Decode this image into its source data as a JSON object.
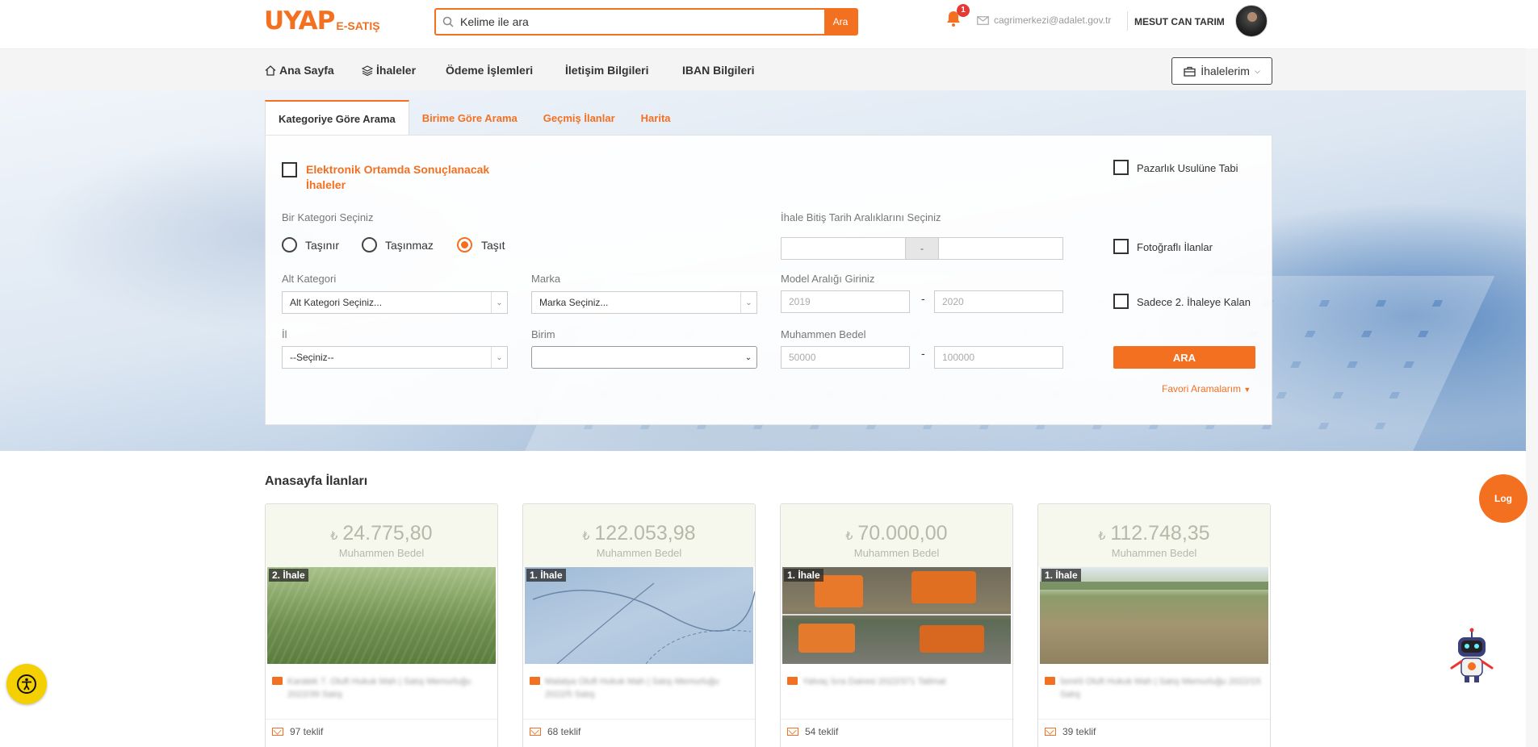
{
  "header": {
    "logo_main": "UYAP",
    "logo_sub": "E-SATIŞ",
    "search_placeholder": "Kelime ile ara",
    "search_button": "Ara",
    "notification_count": "1",
    "email": "cagrimerkezi@adalet.gov.tr",
    "user_name": "MESUT CAN TARIM"
  },
  "nav": {
    "items": [
      "Ana Sayfa",
      "İhaleler",
      "Ödeme İşlemleri",
      "İletişim Bilgileri",
      "IBAN Bilgileri"
    ],
    "my_tenders": "İhalelerim"
  },
  "tabs": [
    "Kategoriye Göre Arama",
    "Birime Göre Arama",
    "Geçmiş İlanlar",
    "Harita"
  ],
  "form": {
    "electronic_label_1": "Elektronik Ortamda Sonuçlanacak",
    "electronic_label_2": "İhaleler",
    "bargain_label": "Pazarlık Usulüne Tabi",
    "category_label": "Bir Kategori Seçiniz",
    "radios": [
      "Taşınır",
      "Taşınmaz",
      "Taşıt"
    ],
    "selected_radio": "Taşıt",
    "date_range_label": "İhale Bitiş Tarih Aralıklarını Seçiniz",
    "date_sep": "-",
    "photo_label": "Fotoğraflı İlanlar",
    "subcategory_label": "Alt Kategori",
    "subcategory_value": "Alt Kategori Seçiniz...",
    "brand_label": "Marka",
    "brand_value": "Marka Seçiniz...",
    "model_label": "Model Aralığı Giriniz",
    "model_from": "2019",
    "model_to": "2020",
    "range_sep": "-",
    "second_tender_label": "Sadece 2. İhaleye Kalan",
    "city_label": "İl",
    "city_value": "--Seçiniz--",
    "unit_label": "Birim",
    "unit_value": "",
    "price_label": "Muhammen Bedel",
    "price_from": "50000",
    "price_to": "100000",
    "search_button": "ARA",
    "favorites": "Favori Aramalarım"
  },
  "listings": {
    "title": "Anasayfa İlanları",
    "currency": "₺",
    "price_caption": "Muhammen Bedel",
    "cards": [
      {
        "price": "24.775,80",
        "tag": "2. İhale",
        "desc": "Karatek 7. Oluft Hukuk Mah | Satış Memurluğu 2022/39 Satış",
        "offers": "97 teklif"
      },
      {
        "price": "122.053,98",
        "tag": "1. İhale",
        "desc": "Malatya Oluft Hukuk Mah | Satış Memurluğu 2022/5 Satış",
        "offers": "68 teklif"
      },
      {
        "price": "70.000,00",
        "tag": "1. İhale",
        "desc": "Yalvaç İcra Dairesi 2022/371 Talimat",
        "offers": "54 teklif"
      },
      {
        "price": "112.748,35",
        "tag": "1. İhale",
        "desc": "İsmirli Oluft Hukuk Mah | Satış Memurluğu 2022/15 Satış",
        "offers": "39 teklif"
      }
    ]
  },
  "floating": {
    "log_button": "Log"
  },
  "colors": {
    "accent": "#f37021",
    "price_text": "#b5b9a8",
    "accessibility": "#f5d000"
  }
}
